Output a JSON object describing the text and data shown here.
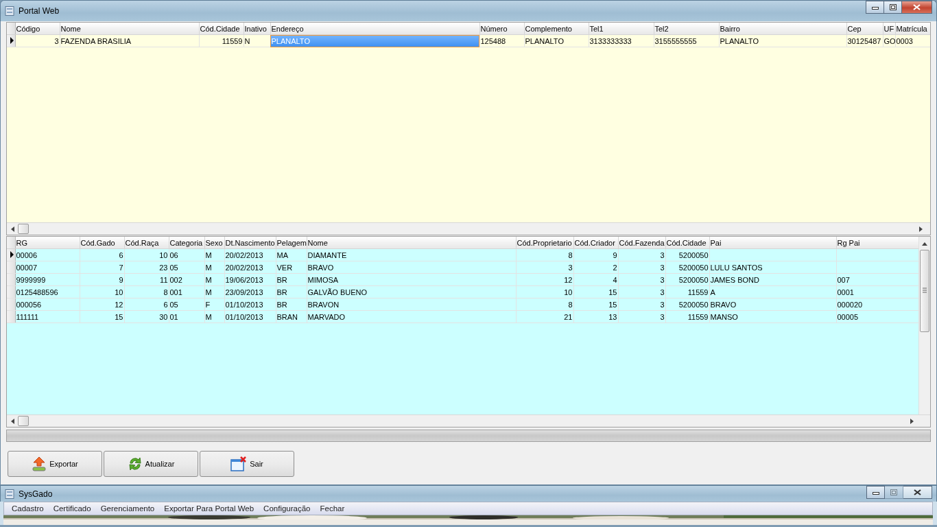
{
  "window": {
    "title": "Portal Web"
  },
  "farm_grid": {
    "columns": [
      {
        "label": "Código",
        "focused": false
      },
      {
        "label": "Nome",
        "focused": false
      },
      {
        "label": "Cód.Cidade",
        "focused": false
      },
      {
        "label": "Inativo",
        "focused": false
      },
      {
        "label": "Endereço",
        "focused": true
      },
      {
        "label": "Número",
        "focused": false
      },
      {
        "label": "Complemento",
        "focused": false
      },
      {
        "label": "Tel1",
        "focused": false
      },
      {
        "label": "Tel2",
        "focused": false
      },
      {
        "label": "Bairro",
        "focused": false
      },
      {
        "label": "Cep",
        "focused": false
      },
      {
        "label": "UF",
        "focused": false
      },
      {
        "label": "Matrícula",
        "focused": false
      }
    ],
    "rows": [
      {
        "current": true,
        "cells": [
          "3",
          "FAZENDA BRASILIA",
          "11559",
          "N",
          "PLANALTO",
          "125488",
          "PLANALTO",
          "3133333333",
          "3155555555",
          "PLANALTO",
          "30125487",
          "GO",
          "0003"
        ]
      }
    ]
  },
  "cattle_grid": {
    "columns": [
      {
        "label": "RG"
      },
      {
        "label": "Cód.Gado"
      },
      {
        "label": "Cód.Raça"
      },
      {
        "label": "Categoria"
      },
      {
        "label": "Sexo"
      },
      {
        "label": "Dt.Nascimento"
      },
      {
        "label": "Pelagem"
      },
      {
        "label": "Nome"
      },
      {
        "label": "Cód.Proprietario"
      },
      {
        "label": "Cód.Criador"
      },
      {
        "label": "Cód.Fazenda"
      },
      {
        "label": "Cód.Cidade"
      },
      {
        "label": "Pai"
      },
      {
        "label": "Rg Pai"
      }
    ],
    "rows": [
      {
        "current": true,
        "cells": [
          "00006",
          "6",
          "10",
          "06",
          "M",
          "20/02/2013",
          "MA",
          "DIAMANTE",
          "8",
          "9",
          "3",
          "5200050",
          null,
          null
        ]
      },
      {
        "current": false,
        "cells": [
          "00007",
          "7",
          "23",
          "05",
          "M",
          "20/02/2013",
          "VER",
          "BRAVO",
          "3",
          "2",
          "3",
          "5200050",
          "LULU SANTOS",
          null
        ]
      },
      {
        "current": false,
        "cells": [
          "9999999",
          "9",
          "11",
          "002",
          "M",
          "19/06/2013",
          "BR",
          "MIMOSA",
          "12",
          "4",
          "3",
          "5200050",
          "JAMES BOND",
          "007"
        ]
      },
      {
        "current": false,
        "cells": [
          "0125488596",
          "10",
          "8",
          "001",
          "M",
          "23/09/2013",
          "BR",
          "GALVÃO BUENO",
          "10",
          "15",
          "3",
          "11559",
          "A",
          "0001"
        ]
      },
      {
        "current": false,
        "cells": [
          "000056",
          "12",
          "6",
          "05",
          "F",
          "01/10/2013",
          "BR",
          "BRAVON",
          "8",
          "15",
          "3",
          "5200050",
          "BRAVO",
          "000020"
        ]
      },
      {
        "current": false,
        "cells": [
          "111111",
          "15",
          "30",
          "01",
          "M",
          "01/10/2013",
          "BRAN",
          "MARVADO",
          "21",
          "13",
          "3",
          "11559",
          "MANSO",
          "00005"
        ]
      }
    ]
  },
  "buttons": [
    {
      "kind": "export",
      "label": "Exportar"
    },
    {
      "kind": "refresh",
      "label": "Atualizar"
    },
    {
      "kind": "exit",
      "label": "Sair"
    }
  ],
  "main_window": {
    "title": "SysGado",
    "menu": [
      "Cadastro",
      "Certificado",
      "Gerenciamento",
      "Exportar Para Portal Web",
      "Configuração",
      "Fechar"
    ]
  }
}
